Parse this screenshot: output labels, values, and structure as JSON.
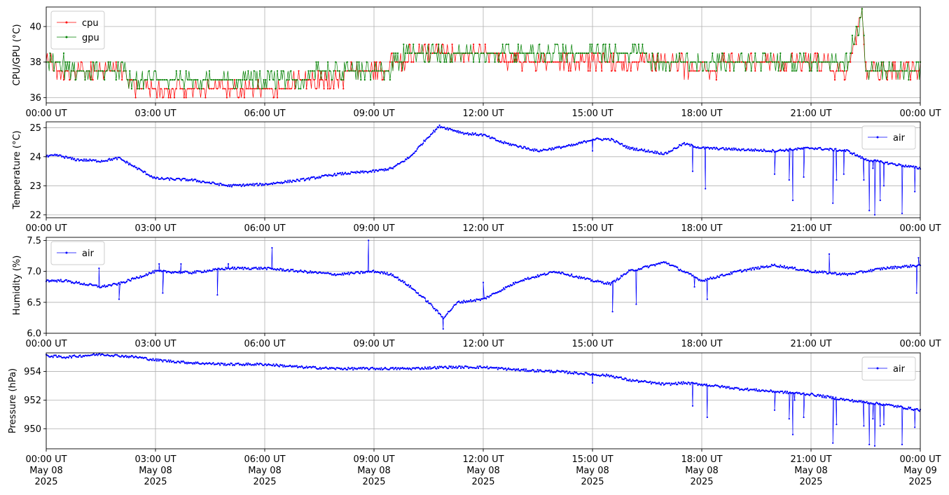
{
  "chart_data": [
    {
      "type": "line",
      "ylabel": "CPU/GPU (°C)",
      "xlabel": "",
      "title": "",
      "grid": true,
      "legend": "top-left",
      "x_range": [
        "2025-05-08 00:00 UT",
        "2025-05-09 00:00 UT"
      ],
      "ylim": [
        35.7,
        41.1
      ],
      "y_ticks": [
        "36",
        "38",
        "40"
      ],
      "x_tick_labels": [
        "00:00 UT",
        "03:00 UT",
        "06:00 UT",
        "09:00 UT",
        "12:00 UT",
        "15:00 UT",
        "18:00 UT",
        "21:00 UT",
        "00:00 UT"
      ],
      "x_hours": [
        0,
        1,
        2,
        2.5,
        3,
        4,
        5,
        6,
        7,
        8,
        9,
        9.5,
        10,
        10.5,
        11,
        12,
        13,
        14,
        15,
        16,
        17,
        18,
        19,
        20,
        21,
        22,
        22.4,
        22.5,
        23,
        24
      ],
      "series": [
        {
          "name": "cpu",
          "color": "#ff0000",
          "values": [
            37.8,
            37.5,
            37.5,
            36.6,
            36.6,
            36.5,
            36.6,
            36.6,
            36.8,
            37.2,
            37.5,
            37.8,
            38.3,
            38.6,
            38.6,
            38.4,
            38.0,
            37.8,
            37.8,
            37.8,
            37.8,
            37.7,
            37.8,
            37.8,
            37.8,
            37.7,
            40.7,
            37.7,
            37.5,
            37.5
          ]
        },
        {
          "name": "gpu",
          "color": "#008000",
          "values": [
            38.0,
            37.5,
            37.5,
            36.9,
            36.8,
            36.8,
            36.9,
            37.0,
            37.2,
            37.4,
            37.5,
            37.7,
            38.6,
            38.6,
            38.6,
            38.6,
            38.6,
            38.6,
            38.6,
            38.4,
            38.1,
            38.1,
            38.1,
            38.1,
            38.1,
            38.0,
            40.8,
            37.5,
            37.5,
            37.5
          ]
        }
      ]
    },
    {
      "type": "line",
      "ylabel": "Temperature (°C)",
      "xlabel": "",
      "title": "",
      "grid": true,
      "legend": "top-right",
      "x_range": [
        "2025-05-08 00:00 UT",
        "2025-05-09 00:00 UT"
      ],
      "ylim": [
        21.9,
        25.2
      ],
      "y_ticks": [
        "22",
        "23",
        "24",
        "25"
      ],
      "x_tick_labels": [
        "00:00 UT",
        "03:00 UT",
        "06:00 UT",
        "09:00 UT",
        "12:00 UT",
        "15:00 UT",
        "18:00 UT",
        "21:00 UT",
        "00:00 UT"
      ],
      "x_hours": [
        0,
        0.3,
        0.8,
        1.5,
        2.0,
        2.5,
        3.0,
        4.0,
        5.0,
        6.0,
        7.0,
        8.0,
        9.0,
        9.5,
        10.0,
        10.5,
        10.8,
        11.5,
        12.0,
        12.5,
        13.5,
        14.5,
        15.0,
        15.5,
        16.0,
        17.0,
        17.5,
        18.0,
        19.0,
        20.0,
        21.0,
        22.0,
        22.5,
        23.0,
        24.0
      ],
      "series": [
        {
          "name": "air",
          "color": "#0000ff",
          "values": [
            24.0,
            24.05,
            23.9,
            23.85,
            23.95,
            23.6,
            23.25,
            23.2,
            23.0,
            23.05,
            23.2,
            23.4,
            23.5,
            23.6,
            24.0,
            24.7,
            25.05,
            24.8,
            24.75,
            24.5,
            24.2,
            24.4,
            24.6,
            24.6,
            24.3,
            24.1,
            24.45,
            24.3,
            24.25,
            24.2,
            24.3,
            24.2,
            23.9,
            23.8,
            23.6
          ]
        }
      ],
      "spikes": [
        [
          15.0,
          24.2
        ],
        [
          17.75,
          23.5
        ],
        [
          18.1,
          22.9
        ],
        [
          20.0,
          23.4
        ],
        [
          20.4,
          23.2
        ],
        [
          20.5,
          22.5
        ],
        [
          20.8,
          23.3
        ],
        [
          21.6,
          22.4
        ],
        [
          21.7,
          23.2
        ],
        [
          21.9,
          23.4
        ],
        [
          22.45,
          23.2
        ],
        [
          22.6,
          22.15
        ],
        [
          22.7,
          23.6
        ],
        [
          22.75,
          22.0
        ],
        [
          22.9,
          22.5
        ],
        [
          23.0,
          23.0
        ],
        [
          23.5,
          22.05
        ],
        [
          23.85,
          22.8
        ]
      ]
    },
    {
      "type": "line",
      "ylabel": "Humidity (%)",
      "xlabel": "",
      "title": "",
      "grid": true,
      "legend": "top-left",
      "x_range": [
        "2025-05-08 00:00 UT",
        "2025-05-09 00:00 UT"
      ],
      "ylim": [
        6.0,
        7.55
      ],
      "y_ticks": [
        "6.0",
        "6.5",
        "7.0",
        "7.5"
      ],
      "x_tick_labels": [
        "00:00 UT",
        "03:00 UT",
        "06:00 UT",
        "09:00 UT",
        "12:00 UT",
        "15:00 UT",
        "18:00 UT",
        "21:00 UT",
        "00:00 UT"
      ],
      "x_hours": [
        0,
        0.5,
        1.0,
        1.5,
        2.0,
        2.5,
        3.0,
        4.0,
        5.0,
        6.0,
        7.0,
        8.0,
        9.0,
        9.5,
        10.0,
        10.5,
        10.9,
        11.3,
        12.0,
        12.5,
        13.0,
        14.0,
        15.0,
        15.5,
        16.0,
        17.0,
        17.5,
        18.0,
        19.0,
        20.0,
        21.0,
        22.0,
        23.0,
        24.0
      ],
      "series": [
        {
          "name": "air",
          "color": "#0000ff",
          "values": [
            6.85,
            6.85,
            6.8,
            6.75,
            6.8,
            6.9,
            7.0,
            6.98,
            7.05,
            7.05,
            7.0,
            6.95,
            7.0,
            6.95,
            6.75,
            6.5,
            6.25,
            6.5,
            6.55,
            6.7,
            6.85,
            7.0,
            6.85,
            6.8,
            7.0,
            7.15,
            7.0,
            6.85,
            7.0,
            7.1,
            7.0,
            6.95,
            7.05,
            7.1
          ]
        }
      ],
      "spikes": [
        [
          1.45,
          7.05
        ],
        [
          2.0,
          6.55
        ],
        [
          3.1,
          7.12
        ],
        [
          3.2,
          6.65
        ],
        [
          3.7,
          7.12
        ],
        [
          4.7,
          6.62
        ],
        [
          5.0,
          7.12
        ],
        [
          6.2,
          7.38
        ],
        [
          8.85,
          7.5
        ],
        [
          10.9,
          6.07
        ],
        [
          12.0,
          6.82
        ],
        [
          15.55,
          6.35
        ],
        [
          16.2,
          6.47
        ],
        [
          17.8,
          6.75
        ],
        [
          18.15,
          6.55
        ],
        [
          21.5,
          7.28
        ],
        [
          23.9,
          6.65
        ],
        [
          23.95,
          7.22
        ]
      ]
    },
    {
      "type": "line",
      "ylabel": "Pressure (hPa)",
      "xlabel": "",
      "title": "",
      "grid": true,
      "legend": "top-right",
      "x_range": [
        "2025-05-08 00:00 UT",
        "2025-05-09 00:00 UT"
      ],
      "ylim": [
        948.6,
        955.3
      ],
      "y_ticks": [
        "950",
        "952",
        "954"
      ],
      "x_tick_labels": [
        "00:00 UT\nMay 08\n2025",
        "03:00 UT\nMay 08\n2025",
        "06:00 UT\nMay 08\n2025",
        "09:00 UT\nMay 08\n2025",
        "12:00 UT\nMay 08\n2025",
        "15:00 UT\nMay 08\n2025",
        "18:00 UT\nMay 08\n2025",
        "21:00 UT\nMay 08\n2025",
        "00:00 UT\nMay 09\n2025"
      ],
      "x_hours": [
        0,
        0.5,
        1.0,
        1.5,
        2.0,
        2.5,
        3.0,
        4.0,
        5.0,
        6.0,
        7.0,
        8.0,
        9.0,
        10.0,
        11.0,
        12.0,
        13.0,
        14.0,
        15.0,
        15.5,
        16.0,
        17.0,
        17.5,
        18.0,
        19.0,
        20.0,
        21.0,
        22.0,
        23.0,
        24.0
      ],
      "series": [
        {
          "name": "air",
          "color": "#0000ff",
          "values": [
            955.1,
            955.0,
            955.1,
            955.2,
            955.1,
            955.0,
            954.8,
            954.6,
            954.5,
            954.5,
            954.3,
            954.2,
            954.2,
            954.2,
            954.3,
            954.3,
            954.1,
            954.0,
            953.8,
            953.7,
            953.4,
            953.1,
            953.2,
            953.1,
            952.8,
            952.6,
            952.4,
            952.0,
            951.7,
            951.3
          ]
        }
      ],
      "spikes": [
        [
          15.0,
          953.2
        ],
        [
          17.75,
          951.6
        ],
        [
          18.15,
          950.8
        ],
        [
          20.0,
          951.3
        ],
        [
          20.4,
          950.7
        ],
        [
          20.5,
          949.6
        ],
        [
          20.55,
          952.0
        ],
        [
          20.8,
          950.8
        ],
        [
          21.6,
          949.0
        ],
        [
          21.7,
          950.3
        ],
        [
          22.45,
          950.2
        ],
        [
          22.6,
          948.9
        ],
        [
          22.7,
          950.7
        ],
        [
          22.75,
          948.8
        ],
        [
          22.9,
          950.2
        ],
        [
          23.0,
          950.3
        ],
        [
          23.5,
          948.9
        ],
        [
          23.85,
          950.1
        ]
      ]
    }
  ]
}
